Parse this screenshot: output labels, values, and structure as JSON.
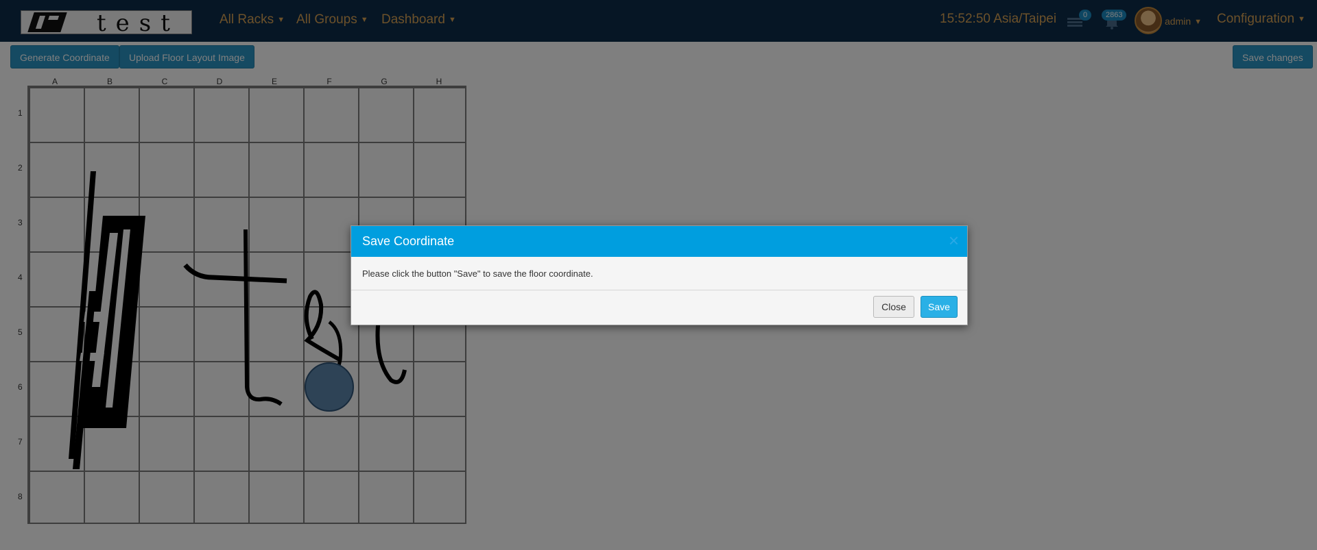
{
  "navbar": {
    "logo_text": "test",
    "menu": [
      {
        "label": "All Racks"
      },
      {
        "label": "All Groups"
      },
      {
        "label": "Dashboard"
      }
    ],
    "clock": "15:52:50 Asia/Taipei",
    "messages_badge": "0",
    "alerts_badge": "2863",
    "user": "admin",
    "configuration": "Configuration"
  },
  "toolbar": {
    "generate_label": "Generate Coordinate",
    "upload_label": "Upload Floor Layout Image",
    "save_changes_label": "Save changes"
  },
  "grid": {
    "columns": [
      "A",
      "B",
      "C",
      "D",
      "E",
      "F",
      "G",
      "H"
    ],
    "rows": [
      "1",
      "2",
      "3",
      "4",
      "5",
      "6",
      "7",
      "8"
    ],
    "selected_cell": "F6"
  },
  "modal": {
    "title": "Save Coordinate",
    "close_x": "×",
    "body": "Please click the button \"Save\" to save the floor coordinate.",
    "close_label": "Close",
    "save_label": "Save"
  },
  "colors": {
    "navbar": "#0c2d4a",
    "nav_text": "#d9a255",
    "primary_button": "#2a95c4",
    "modal_header": "#009edf",
    "badge": "#1b8cc4"
  }
}
